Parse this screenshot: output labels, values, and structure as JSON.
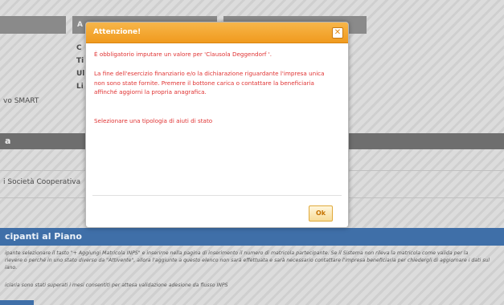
{
  "background": {
    "label_letters": [
      "C",
      "Ti",
      "Ul",
      "Li"
    ],
    "smart_text": "vo SMART",
    "section1_title": "a",
    "company_text": "i Società Cooperativa",
    "participants_title": "cipanti al Piano",
    "participants_note_1": "ipante selezionare il tasto \"+ Aggiungi Matricola INPS\" e inserirne nella pagina di inserimento il numero di matricola partecipante. Se il Sistema non rileva la matricola come valida per la",
    "participants_note_2": "rievere o perché in uno stato diverso da \"Attivente\", allora l'aggiunte a questo elenco non sarà effettuata e sarà necessario contattare l'impresa beneficiaria per chiedergli di aggiornare i dati sul",
    "participants_note_3": "iano.",
    "participants_note_4": "iciaria sono stati superati i mesi consentiti per attesa validazione adesione da flusso INPS",
    "dialog_letter": "A"
  },
  "dialog": {
    "title": "Attenzione!",
    "close_symbol": "✕",
    "message_1": "È obbligatorio imputare un valore per 'Clausola Deggendorf '.",
    "message_2": "La fine dell'esercizio finanziario e/o la dichiarazione riguardante l'impresa unica non sono state fornite. Premere il bottone carica o contattare la beneficiaria affinché aggiorni la propria anagrafica.",
    "message_3": "Selezionare una tipologia di aiuti di stato",
    "ok_label": "Ok"
  },
  "colors": {
    "header_orange": "#f09a1e",
    "message_red": "#e03333",
    "blue_bar": "#3f6fa8"
  }
}
